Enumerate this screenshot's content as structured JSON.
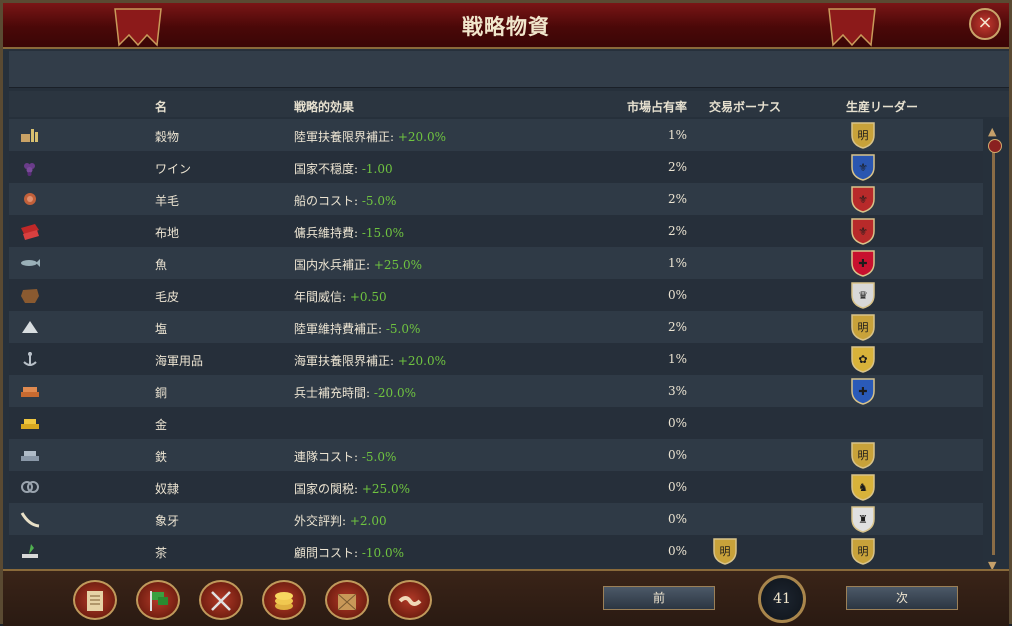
{
  "window": {
    "title": "戦略物資",
    "close_label": "×"
  },
  "columns": {
    "name": "名",
    "effect": "戦略的効果",
    "market_share": "市場占有率",
    "trade_bonus": "交易ボーナス",
    "production_leader": "生産リーダー"
  },
  "rows": [
    {
      "icon": "grain-icon",
      "name": "穀物",
      "effect_label": "陸軍扶養限界補正: ",
      "effect_value": "+20.0%",
      "share": "1%",
      "trade_bonus": null,
      "leader": {
        "fill": "#c8a23a",
        "glyph": "明"
      }
    },
    {
      "icon": "wine-icon",
      "name": "ワイン",
      "effect_label": "国家不穏度: ",
      "effect_value": "-1.00",
      "share": "2%",
      "trade_bonus": null,
      "leader": {
        "fill": "#2a56b0",
        "glyph": "⚜"
      }
    },
    {
      "icon": "wool-icon",
      "name": "羊毛",
      "effect_label": "船のコスト: ",
      "effect_value": "-5.0%",
      "share": "2%",
      "trade_bonus": null,
      "leader": {
        "fill": "#b82a2a",
        "glyph": "⚜"
      }
    },
    {
      "icon": "cloth-icon",
      "name": "布地",
      "effect_label": "傭兵維持費: ",
      "effect_value": "-15.0%",
      "share": "2%",
      "trade_bonus": null,
      "leader": {
        "fill": "#b82a2a",
        "glyph": "⚜"
      }
    },
    {
      "icon": "fish-icon",
      "name": "魚",
      "effect_label": "国内水兵補正: ",
      "effect_value": "+25.0%",
      "share": "1%",
      "trade_bonus": null,
      "leader": {
        "fill": "#c8102e",
        "glyph": "✚"
      }
    },
    {
      "icon": "fur-icon",
      "name": "毛皮",
      "effect_label": "年間威信: ",
      "effect_value": "+0.50",
      "share": "0%",
      "trade_bonus": null,
      "leader": {
        "fill": "#d8d8d8",
        "glyph": "♛"
      }
    },
    {
      "icon": "salt-icon",
      "name": "塩",
      "effect_label": "陸軍維持費補正: ",
      "effect_value": "-5.0%",
      "share": "2%",
      "trade_bonus": null,
      "leader": {
        "fill": "#c8a23a",
        "glyph": "明"
      }
    },
    {
      "icon": "naval-supplies-icon",
      "name": "海軍用品",
      "effect_label": "海軍扶養限界補正: ",
      "effect_value": "+20.0%",
      "share": "1%",
      "trade_bonus": null,
      "leader": {
        "fill": "#d8b23a",
        "glyph": "✿"
      }
    },
    {
      "icon": "copper-icon",
      "name": "銅",
      "effect_label": "兵士補充時間: ",
      "effect_value": "-20.0%",
      "share": "3%",
      "trade_bonus": null,
      "leader": {
        "fill": "#2a5ab8",
        "glyph": "✚"
      }
    },
    {
      "icon": "gold-icon",
      "name": "金",
      "effect_label": "",
      "effect_value": "",
      "share": "0%",
      "trade_bonus": null,
      "leader": null
    },
    {
      "icon": "iron-icon",
      "name": "鉄",
      "effect_label": "連隊コスト: ",
      "effect_value": "-5.0%",
      "share": "0%",
      "trade_bonus": null,
      "leader": {
        "fill": "#c8a23a",
        "glyph": "明"
      }
    },
    {
      "icon": "slaves-icon",
      "name": "奴隷",
      "effect_label": "国家の関税: ",
      "effect_value": "+25.0%",
      "share": "0%",
      "trade_bonus": null,
      "leader": {
        "fill": "#d8b23a",
        "glyph": "♞"
      }
    },
    {
      "icon": "ivory-icon",
      "name": "象牙",
      "effect_label": "外交評判: ",
      "effect_value": "+2.00",
      "share": "0%",
      "trade_bonus": null,
      "leader": {
        "fill": "#e0e0e0",
        "glyph": "♜"
      }
    },
    {
      "icon": "tea-icon",
      "name": "茶",
      "effect_label": "顧問コスト: ",
      "effect_value": "-10.0%",
      "share": "0%",
      "trade_bonus": {
        "fill": "#c8a23a",
        "glyph": "明"
      },
      "leader": {
        "fill": "#c8a23a",
        "glyph": "明"
      }
    }
  ],
  "footer": {
    "prev_label": "前",
    "next_label": "次",
    "page": "41",
    "tabs": [
      "ledger-icon",
      "flags-icon",
      "crossed-swords-icon",
      "coins-icon",
      "crate-icon",
      "handshake-icon"
    ]
  },
  "colors": {
    "positive": "#6fc440",
    "title_bar": "#6a1010",
    "frame": "#8a6a3a"
  }
}
